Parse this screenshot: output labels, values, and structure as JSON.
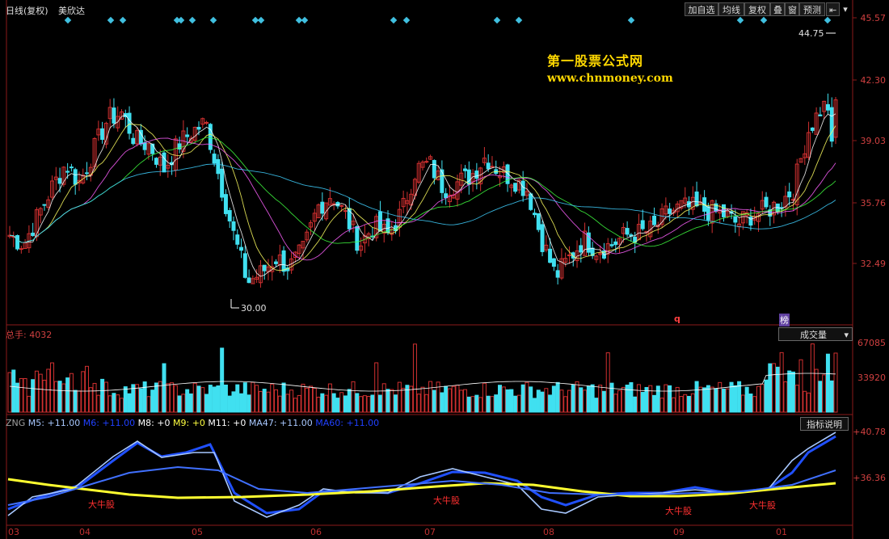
{
  "header": {
    "title": "日线(复权)",
    "stock_name": "美欣达",
    "buttons": [
      "加自选",
      "均线",
      "复权",
      "叠",
      "窗",
      "预测"
    ],
    "prev_icon": "prev-icon",
    "menu_icon": "dropdown-icon"
  },
  "price_panel": {
    "axis_labels": [
      "45.57",
      "42.30",
      "39.03",
      "35.76",
      "32.49"
    ],
    "high_label": "44.75",
    "low_label": "30.00",
    "q_marker": "q",
    "bang_marker": "榜"
  },
  "watermark": {
    "line1": "第一股票公式网",
    "line2": "www.chnmoney.com"
  },
  "volume_panel": {
    "label": "总手: 4032",
    "selector": "成交量",
    "axis_labels": [
      "67085",
      "33920"
    ]
  },
  "indicator_panel": {
    "legend": [
      {
        "text": "ZNG",
        "color": "#a0a0a0"
      },
      {
        "text": "M5: +11.00",
        "color": "#a8c8ff"
      },
      {
        "text": "M6: +11.00",
        "color": "#2040ff"
      },
      {
        "text": "M8: +0",
        "color": "#ffffff"
      },
      {
        "text": "M9: +0",
        "color": "#ffff40"
      },
      {
        "text": "M11: +0",
        "color": "#ffffff"
      },
      {
        "text": "MA47: +11.00",
        "color": "#a8c8ff"
      },
      {
        "text": "MA60: +11.00",
        "color": "#2040ff"
      }
    ],
    "help_button": "指标说明",
    "axis_labels": [
      "+40.78",
      "+36.36"
    ],
    "bull_labels": [
      "大牛股",
      "大牛股",
      "大牛股",
      "大牛股"
    ]
  },
  "x_axis": {
    "months": [
      "03",
      "04",
      "05",
      "06",
      "07",
      "08",
      "09",
      "01"
    ]
  },
  "colors": {
    "up": "#d03030",
    "down": "#40e0f0",
    "grid": "#8b1a1a",
    "diamond": "#40c0e0"
  }
}
